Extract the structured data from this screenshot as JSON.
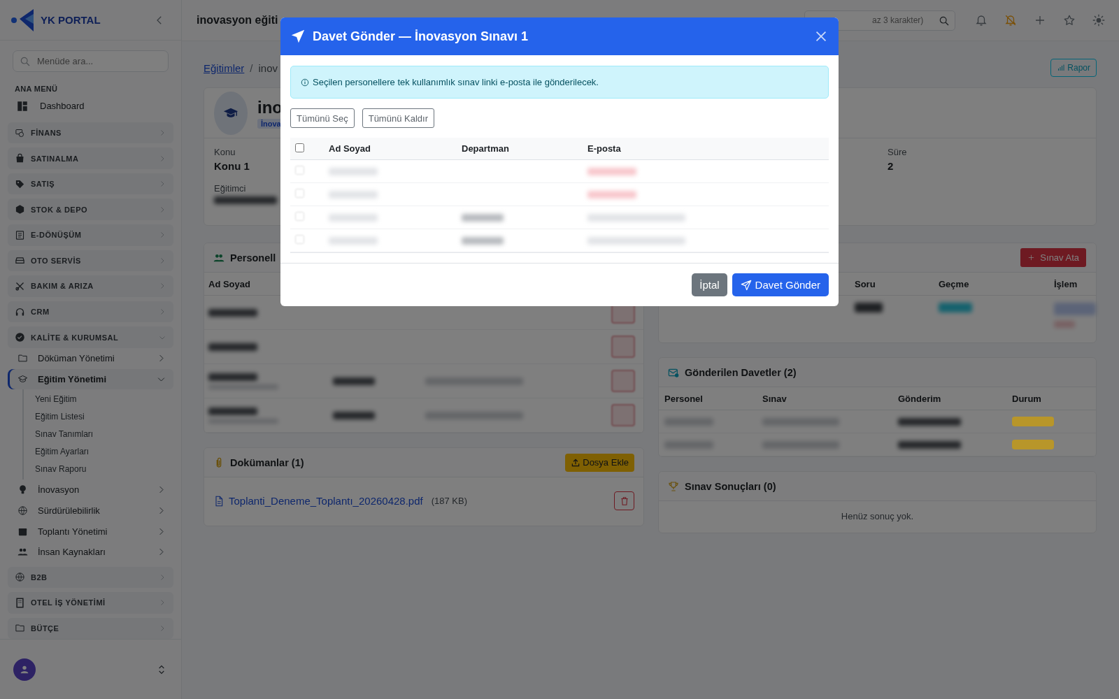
{
  "sidebar": {
    "brand": "YK PORTAL",
    "search": {
      "placeholder": "Menüde ara..."
    },
    "section_label": "ANA MENÜ",
    "items": [
      {
        "kind": "link",
        "label": "Dashboard"
      },
      {
        "kind": "group",
        "label": "FİNANS",
        "expanded": false
      },
      {
        "kind": "group",
        "label": "SATINALMA",
        "expanded": false
      },
      {
        "kind": "group",
        "label": "SATIŞ",
        "expanded": false
      },
      {
        "kind": "group",
        "label": "STOK & DEPO",
        "expanded": false
      },
      {
        "kind": "group",
        "label": "E-DÖNÜŞÜM",
        "expanded": false
      },
      {
        "kind": "group",
        "label": "OTO SERVİS",
        "expanded": false
      },
      {
        "kind": "group",
        "label": "BAKIM & ARIZA",
        "expanded": false
      },
      {
        "kind": "group",
        "label": "CRM",
        "expanded": false
      },
      {
        "kind": "group",
        "label": "KALİTE & KURUMSAL",
        "expanded": true,
        "children": [
          {
            "label": "Döküman Yönetimi",
            "expanded": false,
            "selected": false
          },
          {
            "label": "Eğitim Yönetimi",
            "expanded": true,
            "selected": true,
            "children": [
              {
                "label": "Yeni Eğitim"
              },
              {
                "label": "Eğitim Listesi"
              },
              {
                "label": "Sınav Tanımları"
              },
              {
                "label": "Eğitim Ayarları"
              },
              {
                "label": "Sınav Raporu"
              }
            ]
          },
          {
            "label": "İnovasyon",
            "expanded": false,
            "selected": false
          },
          {
            "label": "Sürdürülebilirlik",
            "expanded": false,
            "selected": false
          },
          {
            "label": "Toplantı Yönetimi",
            "expanded": false,
            "selected": false
          },
          {
            "label": "İnsan Kaynakları",
            "expanded": false,
            "selected": false
          }
        ]
      },
      {
        "kind": "group",
        "label": "B2B",
        "expanded": false
      },
      {
        "kind": "group",
        "label": "OTEL İŞ YÖNETİMİ",
        "expanded": false
      },
      {
        "kind": "group",
        "label": "BÜTÇE",
        "expanded": false
      }
    ]
  },
  "header": {
    "title": "inovasyon eğiti",
    "search": {
      "placeholder": "az 3 karakter)"
    }
  },
  "breadcrumb": [
    {
      "kind": "link",
      "label": "Eğitimler"
    },
    {
      "kind": "separator",
      "label": "/"
    },
    {
      "kind": "current",
      "label": "inov"
    }
  ],
  "report_button": "Rapor",
  "training": {
    "title": "ino",
    "badge": "İnova",
    "left_fields": [
      {
        "label": "Konu",
        "value": "Konu 1"
      },
      {
        "label": "Eğitimci",
        "redacted": true
      }
    ],
    "right_fields": [
      {
        "label": "Süre",
        "value": "2"
      }
    ]
  },
  "personnel": {
    "title": "Personell",
    "columns": [
      "Ad Soyad"
    ],
    "rows": [
      {
        "has_subline": false,
        "has_department": false,
        "has_email": false
      },
      {
        "has_subline": false,
        "has_department": false,
        "has_email": false
      },
      {
        "has_subline": true,
        "has_department": true,
        "has_email": true
      },
      {
        "has_subline": true,
        "has_department": true,
        "has_email": true
      }
    ]
  },
  "documents": {
    "title": "Dokümanlar (1)",
    "action": "Dosya Ekle",
    "files": [
      {
        "name": "Toplanti_Deneme_Toplantı_20260428.pdf",
        "size": "(187 KB)"
      }
    ]
  },
  "exams": {
    "action": "Sınav Ata",
    "columns": [
      "Soru",
      "Geçme",
      "İşlem"
    ],
    "rows": [
      {
        "kind": "redacted"
      }
    ]
  },
  "invitations": {
    "title": "Gönderilen Davetler (2)",
    "columns": [
      "Personel",
      "Sınav",
      "Gönderim",
      "Durum"
    ],
    "rows": [
      {
        "color": "#b8962a"
      },
      {
        "color": "#b8962a"
      }
    ]
  },
  "results": {
    "title": "Sınav Sonuçları (0)",
    "empty": "Henüz sonuç yok."
  },
  "modal": {
    "title": "Davet Gönder — İnovasyon Sınavı 1",
    "info": "Seçilen personellere tek kullanımlık sınav linki e-posta ile gönderilecek.",
    "select_all": "Tümünü Seç",
    "clear_all": "Tümünü Kaldır",
    "all_checked": false,
    "columns": [
      "Ad Soyad",
      "Departman",
      "E-posta"
    ],
    "rows": [
      {
        "checked": false,
        "has_department": false,
        "email_missing": true
      },
      {
        "checked": false,
        "has_department": false,
        "email_missing": true
      },
      {
        "checked": false,
        "has_department": true,
        "email_missing": false
      },
      {
        "checked": false,
        "has_department": true,
        "email_missing": false
      }
    ],
    "cancel": "İptal",
    "submit": "Davet Gönder"
  }
}
